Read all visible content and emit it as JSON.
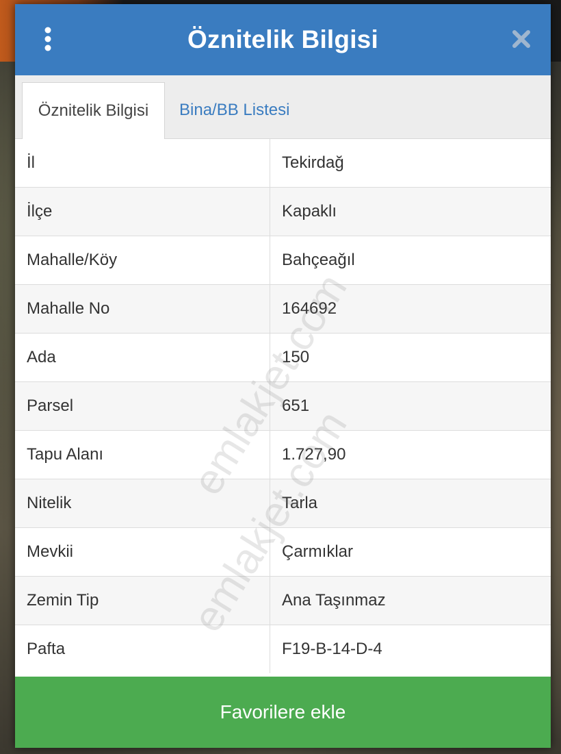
{
  "dialog": {
    "title": "Öznitelik Bilgisi",
    "header_color": "#3a7cc0"
  },
  "tabs": [
    {
      "label": "Öznitelik Bilgisi",
      "active": true
    },
    {
      "label": "Bina/BB Listesi",
      "active": false
    }
  ],
  "attributes": [
    {
      "key": "İl",
      "value": "Tekirdağ"
    },
    {
      "key": "İlçe",
      "value": "Kapaklı"
    },
    {
      "key": "Mahalle/Köy",
      "value": "Bahçeağıl"
    },
    {
      "key": "Mahalle No",
      "value": "164692"
    },
    {
      "key": "Ada",
      "value": "150"
    },
    {
      "key": "Parsel",
      "value": "651"
    },
    {
      "key": "Tapu Alanı",
      "value": "1.727,90"
    },
    {
      "key": "Nitelik",
      "value": "Tarla"
    },
    {
      "key": "Mevkii",
      "value": "Çarmıklar"
    },
    {
      "key": "Zemin Tip",
      "value": "Ana Taşınmaz"
    },
    {
      "key": "Pafta",
      "value": "F19-B-14-D-4"
    }
  ],
  "footer": {
    "favorite_label": "Favorilere ekle",
    "button_color": "#4cab50"
  },
  "watermark": {
    "text1": "emlakjet.com",
    "text2": "emlakjet.com"
  },
  "icons": {
    "menu": "more-vertical-icon",
    "close": "close-icon"
  }
}
